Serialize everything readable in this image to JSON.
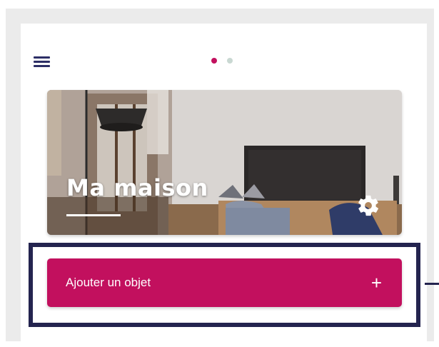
{
  "header": {
    "menu_icon": "hamburger-menu-icon",
    "pager": {
      "count": 2,
      "active_index": 0
    }
  },
  "home_card": {
    "title": "Ma maison",
    "settings_icon": "gear-icon"
  },
  "add_object_button": {
    "label": "Ajouter un objet",
    "icon_glyph": "+"
  },
  "colors": {
    "accent": "#c2105e",
    "navy": "#24244f",
    "page_background": "#ebebeb",
    "pager_inactive": "#c9d8d2"
  }
}
